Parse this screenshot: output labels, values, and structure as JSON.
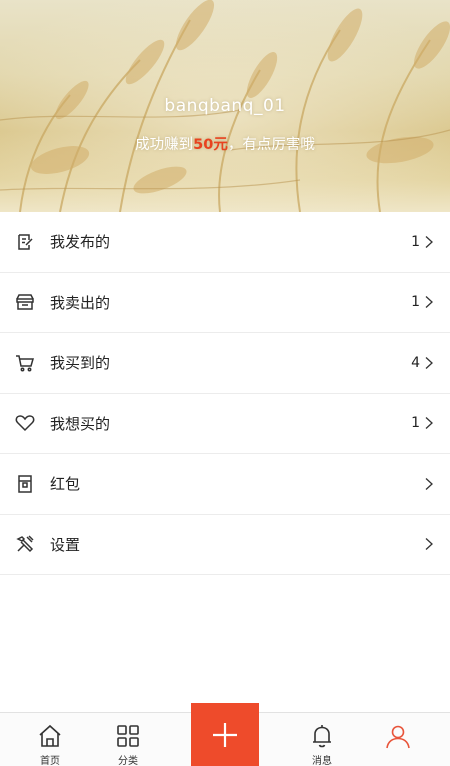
{
  "profile": {
    "username": "banqbanq_01",
    "subline_prefix": "成功赚到",
    "amount": "50元",
    "subline_suffix": "，有点厉害哦"
  },
  "menu": {
    "items": [
      {
        "label": "我发布的",
        "count": "1",
        "icon": "edit-icon"
      },
      {
        "label": "我卖出的",
        "count": "1",
        "icon": "shop-icon"
      },
      {
        "label": "我买到的",
        "count": "4",
        "icon": "cart-icon"
      },
      {
        "label": "我想买的",
        "count": "1",
        "icon": "heart-icon"
      },
      {
        "label": "红包",
        "count": "",
        "icon": "red-envelope-icon"
      },
      {
        "label": "设置",
        "count": "",
        "icon": "wrench-icon"
      }
    ]
  },
  "tabbar": {
    "tabs": [
      {
        "label": "首页",
        "icon": "home-icon"
      },
      {
        "label": "分类",
        "icon": "grid-icon"
      },
      {
        "label": "",
        "icon": "plus-icon"
      },
      {
        "label": "消息",
        "icon": "bell-icon"
      },
      {
        "label": "",
        "icon": "user-icon",
        "active": true
      }
    ]
  },
  "colors": {
    "accent": "#ee4b2b",
    "amount": "#e8431f",
    "active_tab": "#e8543a"
  }
}
